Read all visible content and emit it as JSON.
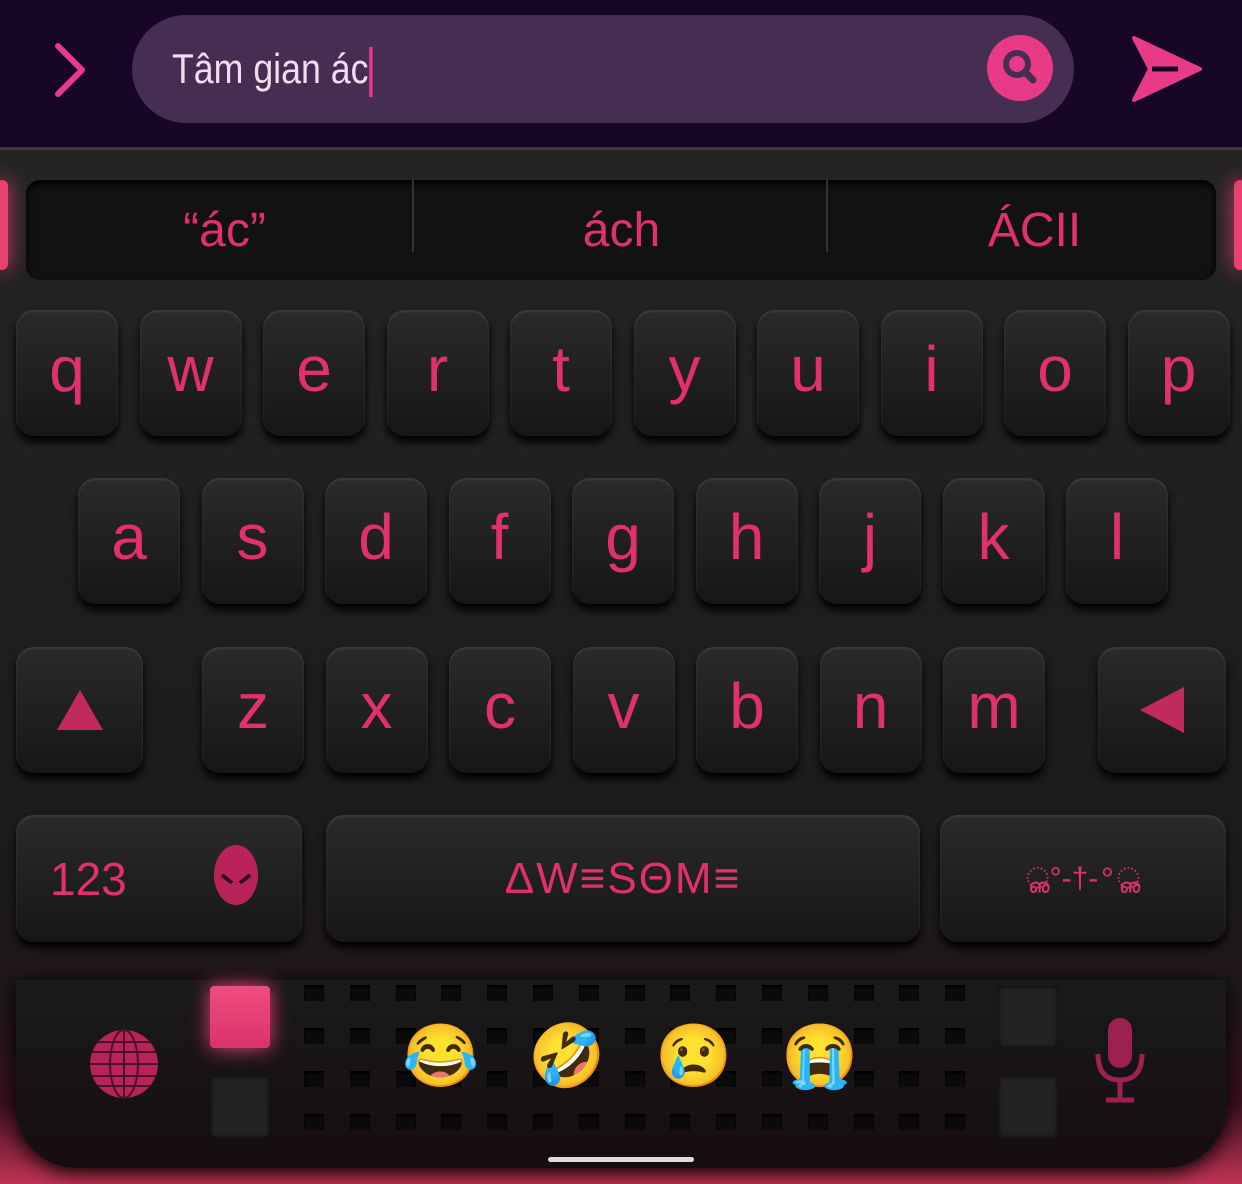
{
  "search": {
    "value": "Tâm gian ác"
  },
  "suggestions": [
    "“ác”",
    "ách",
    "ÁCII"
  ],
  "rows": [
    [
      "q",
      "w",
      "e",
      "r",
      "t",
      "y",
      "u",
      "i",
      "o",
      "p"
    ],
    [
      "a",
      "s",
      "d",
      "f",
      "g",
      "h",
      "j",
      "k",
      "l"
    ],
    [
      "z",
      "x",
      "c",
      "v",
      "b",
      "n",
      "m"
    ]
  ],
  "bottom_row": {
    "numbers_label": "123",
    "space_label": "ΔW≡SΘM≡",
    "ornament_label": "ൢ°-†-°ൢ"
  },
  "emojis": [
    "😂",
    "🤣",
    "😢",
    "😭"
  ],
  "colors": {
    "accent": "#e83a87",
    "key_text": "#e0306f",
    "search_bg": "#462e53"
  }
}
